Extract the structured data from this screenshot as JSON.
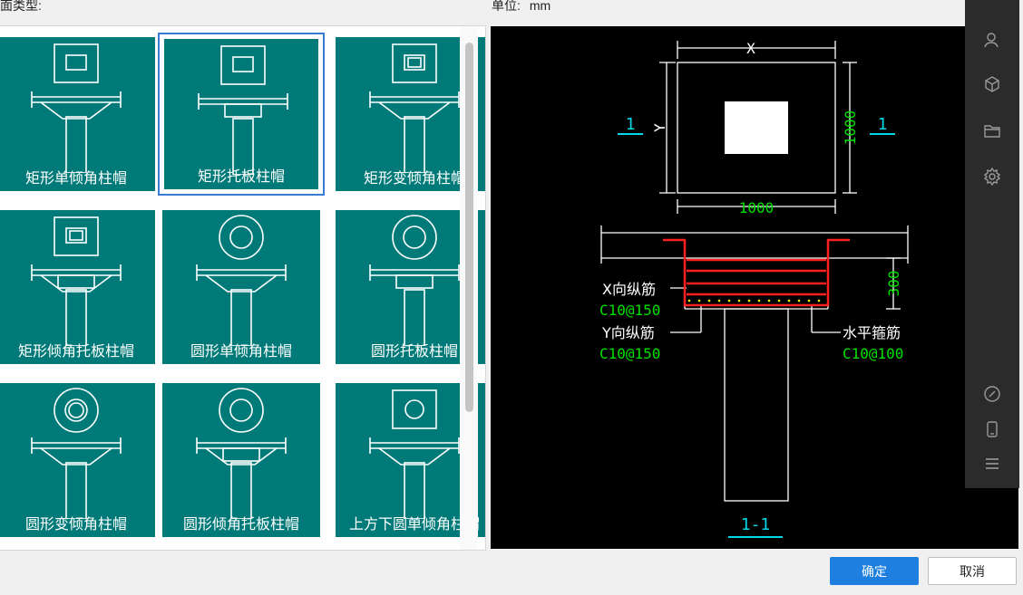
{
  "header": {
    "type_label": "截面类型:",
    "unit_label": "单位:",
    "unit_value": "mm"
  },
  "gallery": {
    "items": [
      {
        "label": "矩形单倾角柱帽"
      },
      {
        "label": "矩形托板柱帽"
      },
      {
        "label": "矩形变倾角柱帽"
      },
      {
        "label": "矩形倾角托板柱帽"
      },
      {
        "label": "圆形单倾角柱帽"
      },
      {
        "label": "圆形托板柱帽"
      },
      {
        "label": "圆形变倾角柱帽"
      },
      {
        "label": "圆形倾角托板柱帽"
      },
      {
        "label": "上方下圆单倾角柱帽"
      }
    ],
    "selected_index": 1
  },
  "preview": {
    "dim_x": "X",
    "dim_y": "Y",
    "dim_width": "1000",
    "dim_height": "1000",
    "section_mark_left": "1",
    "section_mark_right": "1",
    "dim_depth": "300",
    "x_rebar_label": "X向纵筋",
    "x_rebar_value": "C10@150",
    "y_rebar_label": "Y向纵筋",
    "y_rebar_value": "C10@150",
    "stirrup_label": "水平箍筋",
    "stirrup_value": "C10@100",
    "section_title": "1-1",
    "colors": {
      "green": "#00e000",
      "cyan": "#00d8e8",
      "red": "#ff2020",
      "yellow": "#ffff00"
    }
  },
  "sidebar": {
    "icons": [
      "user-icon",
      "cube-icon",
      "folder-icon",
      "settings-icon",
      "link-icon",
      "phone-icon",
      "menu-icon"
    ]
  },
  "buttons": {
    "ok_label": "确定",
    "cancel_label": "取消"
  }
}
